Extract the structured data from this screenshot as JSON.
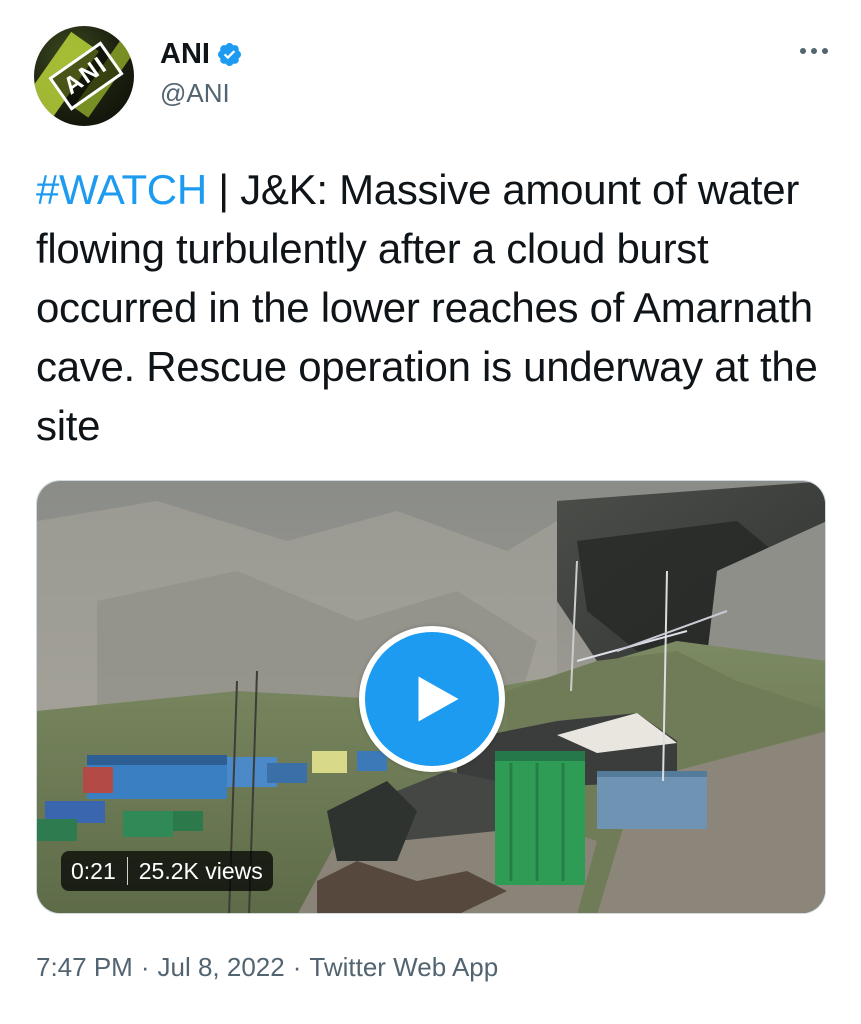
{
  "author": {
    "display_name": "ANI",
    "handle": "@ANI",
    "avatar_text": "ANI",
    "avatar_icon": "ani-logo-icon",
    "verified_icon": "verified-badge-icon"
  },
  "menu": {
    "icon": "more-options-icon"
  },
  "tweet": {
    "hashtag": "#WATCH",
    "body": " | J&K: Massive amount of water flowing turbulently after a cloud burst occurred in the lower reaches of Amarnath cave. Rescue operation is underway at the site"
  },
  "video": {
    "duration": "0:21",
    "views": "25.2K views",
    "play_icon": "play-icon"
  },
  "footer": {
    "time": "7:47 PM",
    "date": "Jul 8, 2022",
    "source": "Twitter Web App",
    "separator": "·"
  },
  "colors": {
    "accent": "#1d9bf0",
    "text": "#0f1419",
    "secondary_text": "#536471"
  }
}
